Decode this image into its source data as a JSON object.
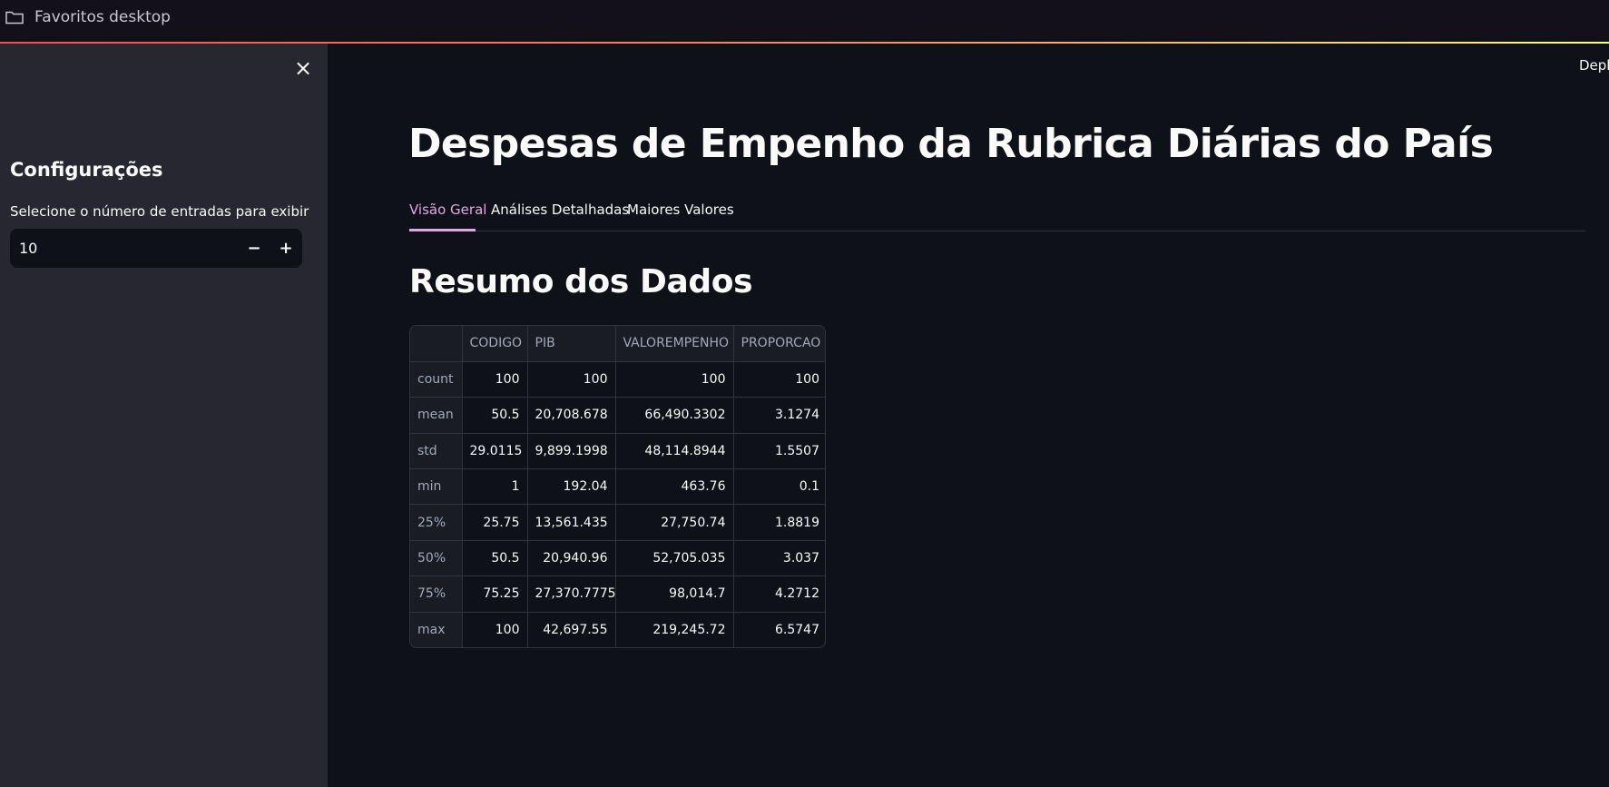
{
  "bookmarks": {
    "folder_label": "Favoritos desktop"
  },
  "sidebar": {
    "header": "Configurações",
    "stepper_label": "Selecione o número de entradas para exibir",
    "stepper_value": "10",
    "minus": "−",
    "plus": "+",
    "close": "×"
  },
  "header": {
    "deploy_label": "Deploy"
  },
  "main": {
    "title": "Despesas de Empenho da Rubrica Diárias do País",
    "tabs": [
      {
        "label": "Visão Geral",
        "active": true
      },
      {
        "label": "Análises Detalhadas",
        "active": false
      },
      {
        "label": "Maiores Valores",
        "active": false
      }
    ],
    "section_title": "Resumo dos Dados",
    "table": {
      "columns": [
        "",
        "CODIGO",
        "PIB",
        "VALOREMPENHO",
        "PROPORCAO"
      ],
      "rows": [
        [
          "count",
          "100",
          "100",
          "100",
          "100"
        ],
        [
          "mean",
          "50.5",
          "20,708.678",
          "66,490.3302",
          "3.1274"
        ],
        [
          "std",
          "29.0115",
          "9,899.1998",
          "48,114.8944",
          "1.5507"
        ],
        [
          "min",
          "1",
          "192.04",
          "463.76",
          "0.1"
        ],
        [
          "25%",
          "25.75",
          "13,561.435",
          "27,750.74",
          "1.8819"
        ],
        [
          "50%",
          "50.5",
          "20,940.96",
          "52,705.035",
          "3.037"
        ],
        [
          "75%",
          "75.25",
          "27,370.7775",
          "98,014.7",
          "4.2712"
        ],
        [
          "max",
          "100",
          "42,697.55",
          "219,245.72",
          "6.5747"
        ]
      ]
    }
  },
  "colors": {
    "accent": "#e5a5e8",
    "background": "#0e1117",
    "sidebar": "#262730"
  }
}
